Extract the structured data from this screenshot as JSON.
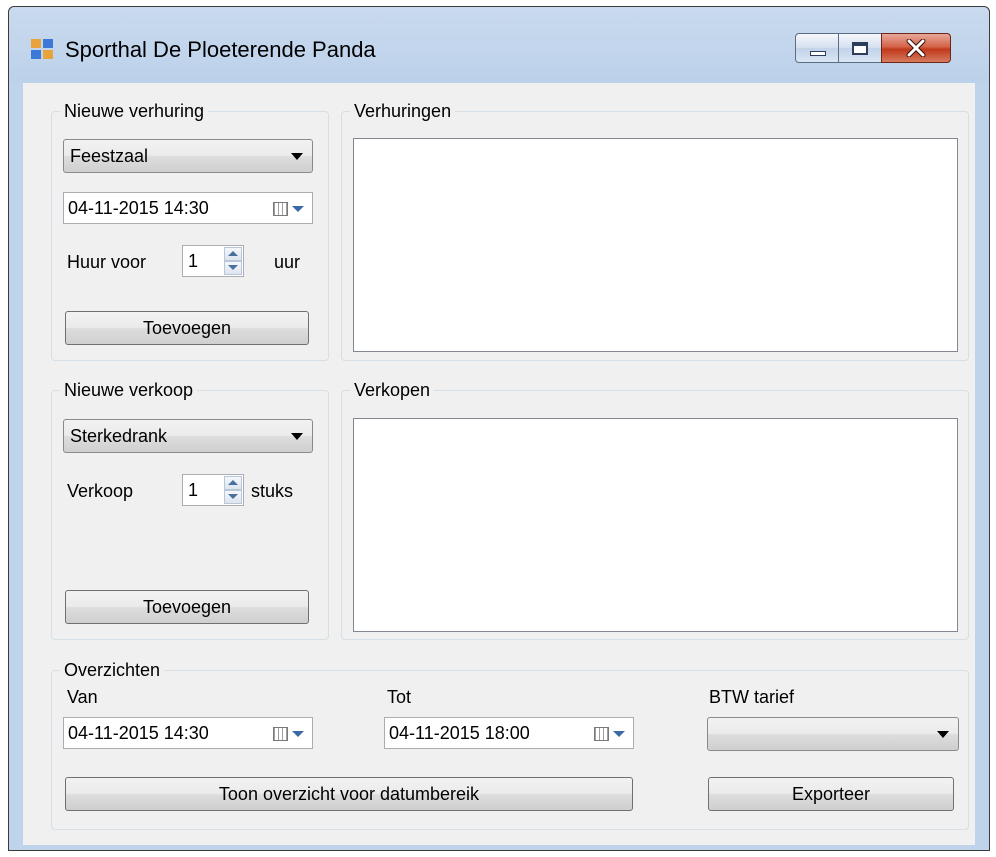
{
  "window": {
    "title": "Sporthal De Ploeterende Panda"
  },
  "nieuwe_verhuring": {
    "title": "Nieuwe verhuring",
    "combo_value": "Feestzaal",
    "date_value": "04-11-2015 14:30",
    "huur_label": "Huur voor",
    "huur_value": "1",
    "uur_label": "uur",
    "add_button": "Toevoegen"
  },
  "verhuringen": {
    "title": "Verhuringen",
    "items": []
  },
  "nieuwe_verkoop": {
    "title": "Nieuwe verkoop",
    "combo_value": "Sterkedrank",
    "verkoop_label": "Verkoop",
    "verkoop_value": "1",
    "stuks_label": "stuks",
    "add_button": "Toevoegen"
  },
  "verkopen": {
    "title": "Verkopen",
    "items": []
  },
  "overzichten": {
    "title": "Overzichten",
    "van_label": "Van",
    "van_value": "04-11-2015 14:30",
    "tot_label": "Tot",
    "tot_value": "04-11-2015 18:00",
    "btw_label": "BTW tarief",
    "btw_value": "",
    "show_button": "Toon overzicht voor datumbereik",
    "export_button": "Exporteer"
  },
  "colors": {
    "titlebar": "#bfd3ea",
    "client_bg": "#f0f0f0",
    "close_button": "#c1391c"
  }
}
